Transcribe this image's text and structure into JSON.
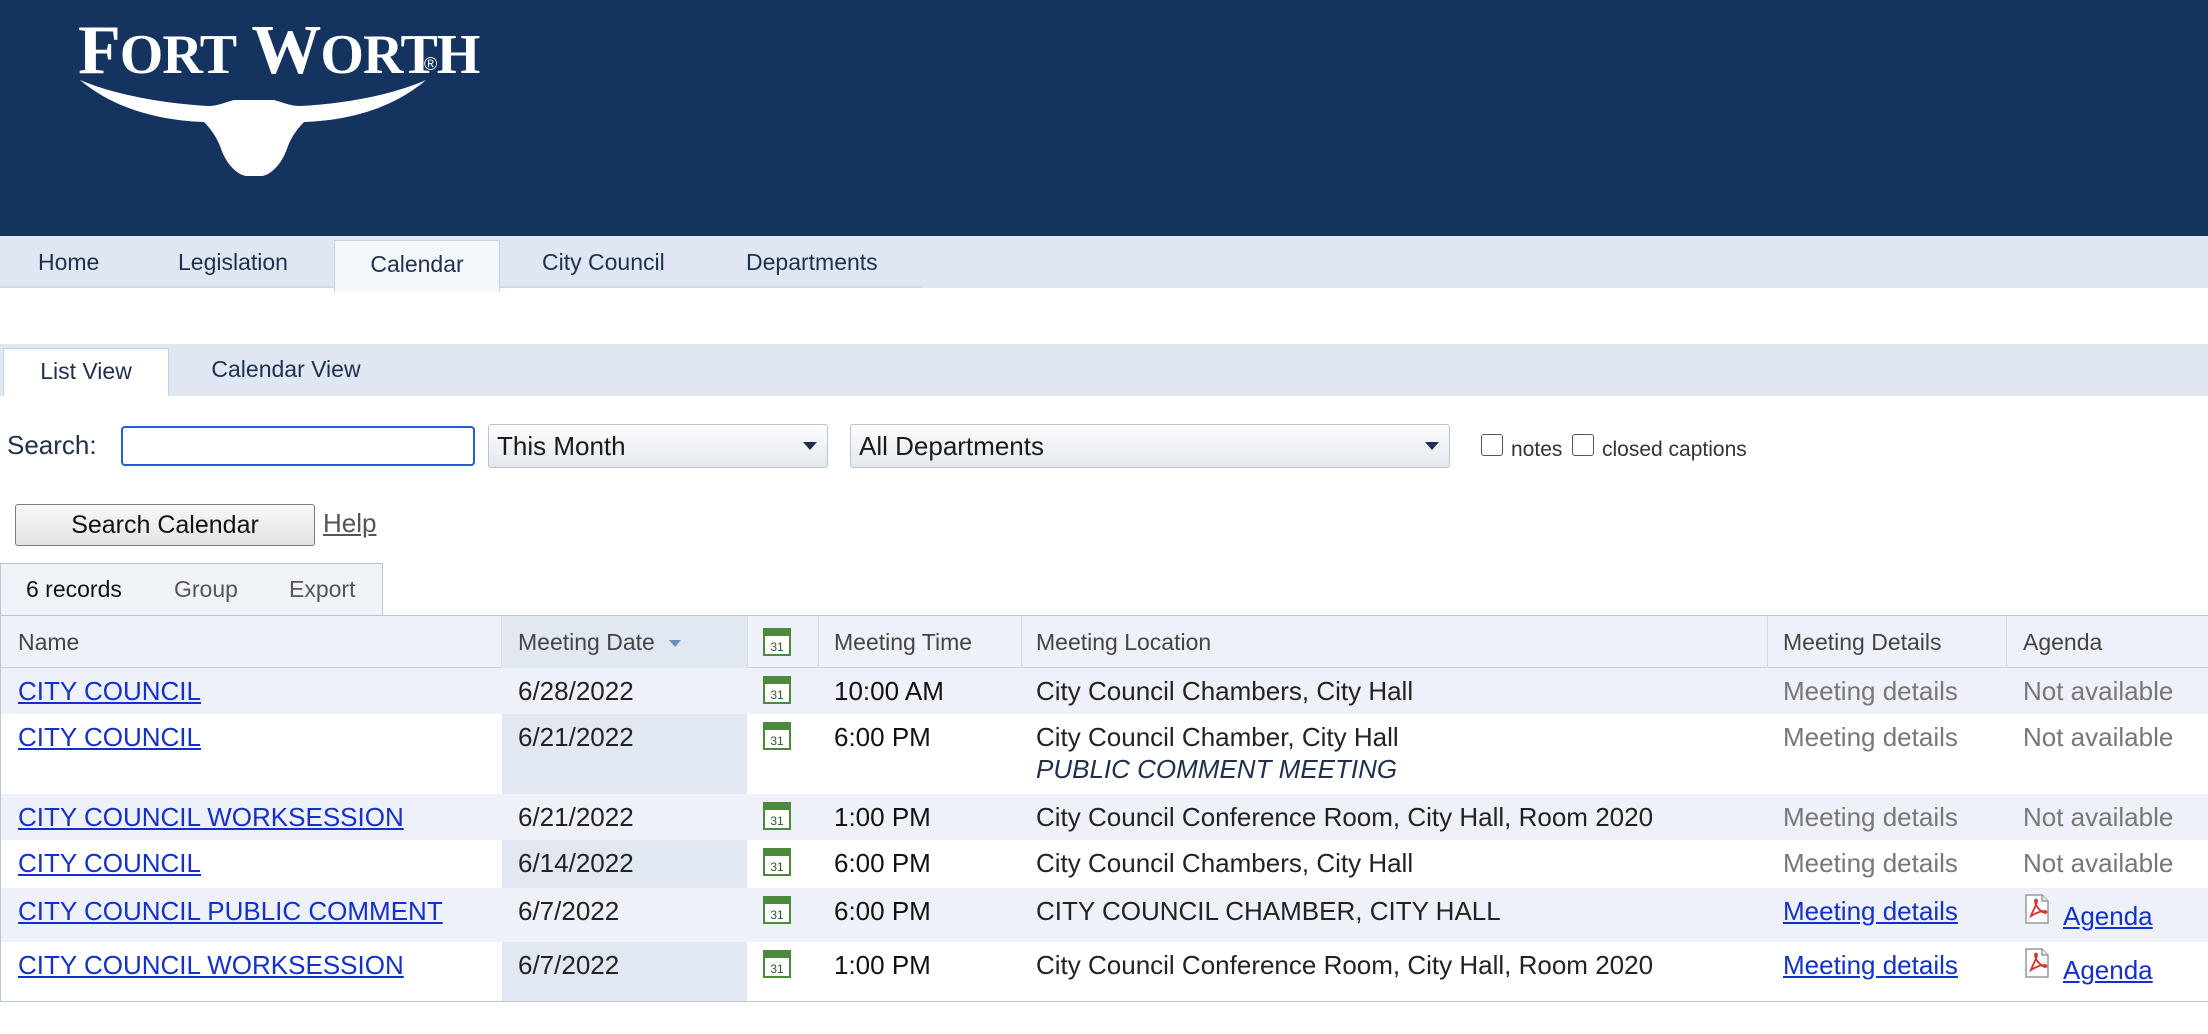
{
  "brand": {
    "logo_text": "FORT WORTH",
    "logo_mark": "longhorn-logo"
  },
  "nav": {
    "items": [
      {
        "label": "Home"
      },
      {
        "label": "Legislation"
      },
      {
        "label": "Calendar"
      },
      {
        "label": "City Council"
      },
      {
        "label": "Departments"
      }
    ],
    "active": "Calendar"
  },
  "subtabs": {
    "list_view": "List View",
    "calendar_view": "Calendar View",
    "active": "List View"
  },
  "search": {
    "label": "Search:",
    "value": "",
    "period": "This Month",
    "department": "All Departments",
    "notes_label": "notes",
    "captions_label": "closed captions",
    "notes_checked": false,
    "captions_checked": false,
    "button": "Search Calendar",
    "help": "Help"
  },
  "records": {
    "count": "6 records",
    "group": "Group",
    "export": "Export"
  },
  "table": {
    "columns": {
      "name": "Name",
      "date": "Meeting Date",
      "cal": "calendar-icon",
      "time": "Meeting Time",
      "location": "Meeting Location",
      "details": "Meeting Details",
      "agenda": "Agenda"
    },
    "rows": [
      {
        "name": "CITY COUNCIL",
        "date": "6/28/2022",
        "time": "10:00 AM",
        "location": "City Council Chambers, City Hall",
        "note": "",
        "details": "Meeting details",
        "agenda": "Not available"
      },
      {
        "name": "CITY COUNCIL",
        "date": "6/21/2022",
        "time": "6:00 PM",
        "location": "City Council Chamber, City Hall",
        "note": "PUBLIC COMMENT MEETING",
        "details": "Meeting details",
        "agenda": "Not available"
      },
      {
        "name": "CITY COUNCIL WORKSESSION",
        "date": "6/21/2022",
        "time": "1:00 PM",
        "location": "City Council Conference Room, City Hall, Room 2020",
        "note": "",
        "details": "Meeting details",
        "agenda": "Not available"
      },
      {
        "name": "CITY COUNCIL",
        "date": "6/14/2022",
        "time": "6:00 PM",
        "location": "City Council Chambers, City Hall",
        "note": "",
        "details": "Meeting details",
        "agenda": "Not available"
      },
      {
        "name": "CITY COUNCIL PUBLIC COMMENT",
        "date": "6/7/2022",
        "time": "6:00 PM",
        "location": "CITY COUNCIL CHAMBER, CITY HALL",
        "note": "",
        "details": "Meeting details",
        "agenda": "Agenda"
      },
      {
        "name": "CITY COUNCIL WORKSESSION",
        "date": "6/7/2022",
        "time": "1:00 PM",
        "location": "City Council Conference Room, City Hall, Room 2020",
        "note": "",
        "details": "Meeting details",
        "agenda": "Agenda"
      }
    ]
  },
  "colors": {
    "header_bg": "#14345f",
    "link": "#1430cc",
    "nav_bg": "#dfe7f2"
  }
}
